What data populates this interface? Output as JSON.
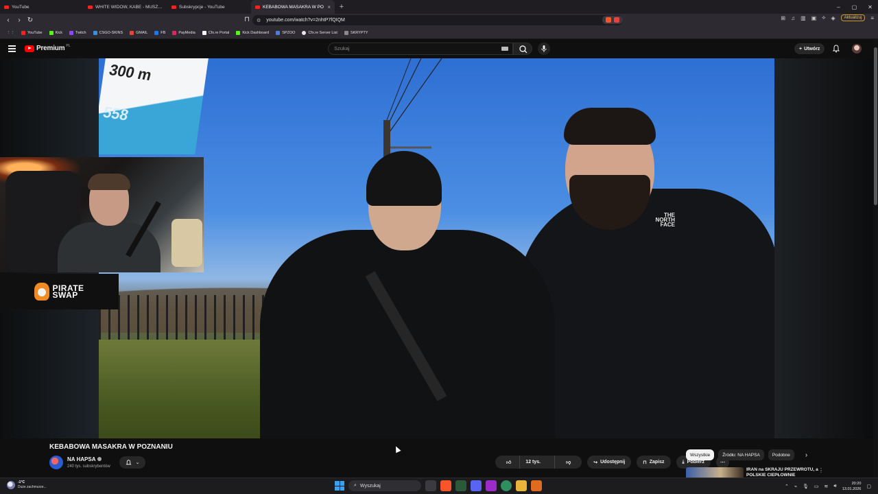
{
  "browser": {
    "tabs": [
      {
        "label": "YouTube",
        "active": false
      },
      {
        "label": "WHITE WIDOW, KABE - MUSZĘ GRAĆ",
        "active": false
      },
      {
        "label": "Subskrypcje - YouTube",
        "active": false
      },
      {
        "label": "KEBABOWA MASAKRA W PO",
        "active": true
      }
    ],
    "url": "youtube.com/watch?v=2nhtP7fQIQM",
    "update_label": "Aktualizuj",
    "bookmarks": [
      "YouTube",
      "Kick",
      "Twitch",
      "CSGO-SKINS",
      "GMAIL",
      "FB",
      "PayMedia",
      "Cfx.re Portal",
      "Kick Dashboard",
      "SPZOO",
      "Cfx.re Server List",
      "SKRYPTY"
    ]
  },
  "youtube": {
    "logo_text": "Premium",
    "logo_region": "PL",
    "search_placeholder": "Szukaj",
    "create_label": "Utwórz"
  },
  "video": {
    "sign_text_top": "300 m",
    "sign_text_bottom": "558",
    "jacket_brand": "THE NORTH FACE",
    "sponsor_top": "PIRATE",
    "sponsor_bottom": "SWAP"
  },
  "details": {
    "title": "KEBABOWA MASAKRA W POZNANIU",
    "channel": "NA HAPSA",
    "subscribers": "240 tys. subskrybentów",
    "likes": "12 tys.",
    "share": "Udostępnij",
    "save": "Zapisz",
    "download": "Pobierz"
  },
  "sidebar": {
    "chips": [
      "Wszystkie",
      "Źródło: NA HAPSA",
      "Podobne"
    ],
    "rec_title": "IRAN na SKRAJU PRZEWROTU, a POLSKIE CIEPŁOWNIE"
  },
  "taskbar": {
    "weather_temp": "-1°C",
    "weather_desc": "Duże zachmurze...",
    "search_label": "Wyszukaj",
    "time": "20:20",
    "date": "13.01.2026"
  },
  "colors": {
    "yt_red": "#ff0000",
    "bg": "#0f0f0f",
    "brave_orange": "#fb542b"
  }
}
